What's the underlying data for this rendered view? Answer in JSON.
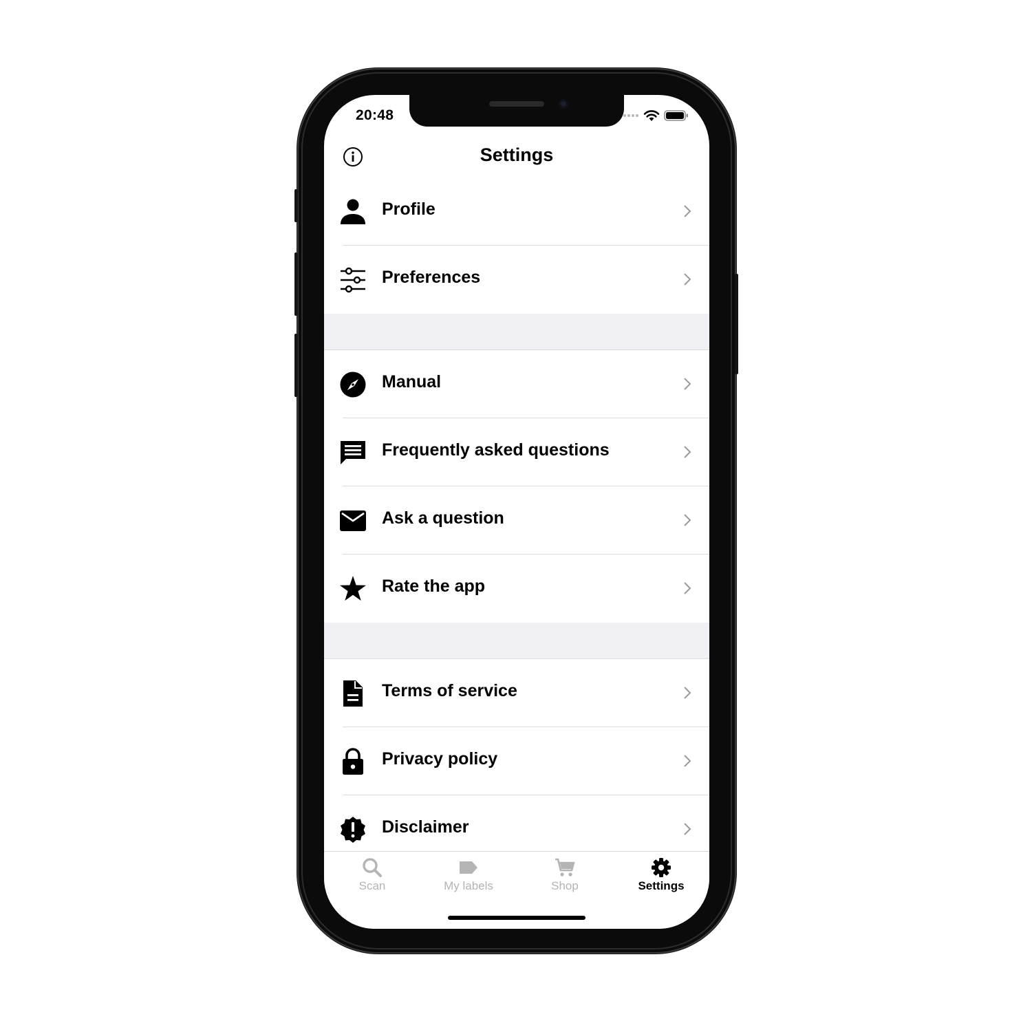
{
  "status_bar": {
    "time": "20:48",
    "icons": [
      "signal-dots-icon",
      "wifi-icon",
      "battery-icon"
    ]
  },
  "nav": {
    "title": "Settings",
    "left_icon": "info-icon"
  },
  "sections": [
    [
      {
        "label": "Profile",
        "icon": "person-icon"
      },
      {
        "label": "Preferences",
        "icon": "sliders-icon"
      }
    ],
    [
      {
        "label": "Manual",
        "icon": "compass-icon"
      },
      {
        "label": "Frequently asked questions",
        "icon": "chat-icon"
      },
      {
        "label": "Ask a question",
        "icon": "mail-icon"
      },
      {
        "label": "Rate the app",
        "icon": "star-icon"
      }
    ],
    [
      {
        "label": "Terms of service",
        "icon": "document-icon"
      },
      {
        "label": "Privacy policy",
        "icon": "lock-icon"
      },
      {
        "label": "Disclaimer",
        "icon": "alert-badge-icon"
      }
    ]
  ],
  "tabbar": {
    "tabs": [
      {
        "label": "Scan",
        "icon": "search-icon",
        "active": false
      },
      {
        "label": "My labels",
        "icon": "tag-icon",
        "active": false
      },
      {
        "label": "Shop",
        "icon": "cart-icon",
        "active": false
      },
      {
        "label": "Settings",
        "icon": "gear-icon",
        "active": true
      }
    ]
  },
  "colors": {
    "text": "#000000",
    "inactive_tab": "#b4b4b4",
    "section_gap": "#efeff4",
    "separator": "#dcdce0",
    "chevron": "#9a9a9e"
  }
}
